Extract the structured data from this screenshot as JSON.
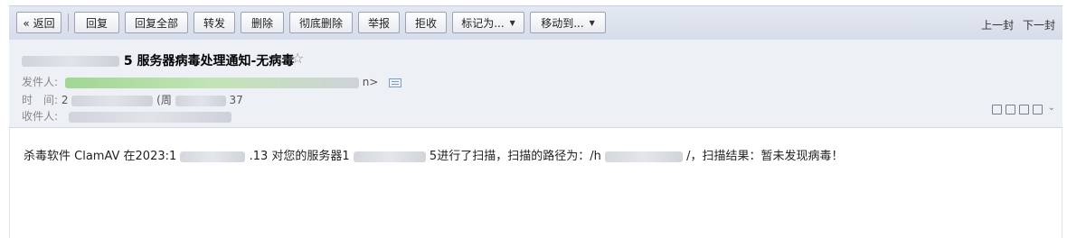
{
  "toolbar": {
    "back": "« 返回",
    "reply": "回复",
    "reply_all": "回复全部",
    "forward": "转发",
    "delete": "删除",
    "delete_perm": "彻底删除",
    "report": "举报",
    "reject": "拒收",
    "mark_as": "标记为...",
    "move_to": "移动到...",
    "prev": "上一封",
    "next": "下一封"
  },
  "mail": {
    "subject_visible": "5 服务器病毒处理通知-无病毒",
    "star": "☆",
    "from_label": "发件人:",
    "from_tail": "n>",
    "time_label": "时　间:",
    "time_start": "2",
    "time_mid": "(周",
    "time_tail": "37",
    "to_label": "收件人:",
    "body_1": "杀毒软件 ClamAV 在2023:1",
    "body_2": ".13 对您的服务器1",
    "body_3": "5进行了扫描，扫描的路径为：/h",
    "body_4": "/，扫描结果：暂未发现病毒！"
  }
}
